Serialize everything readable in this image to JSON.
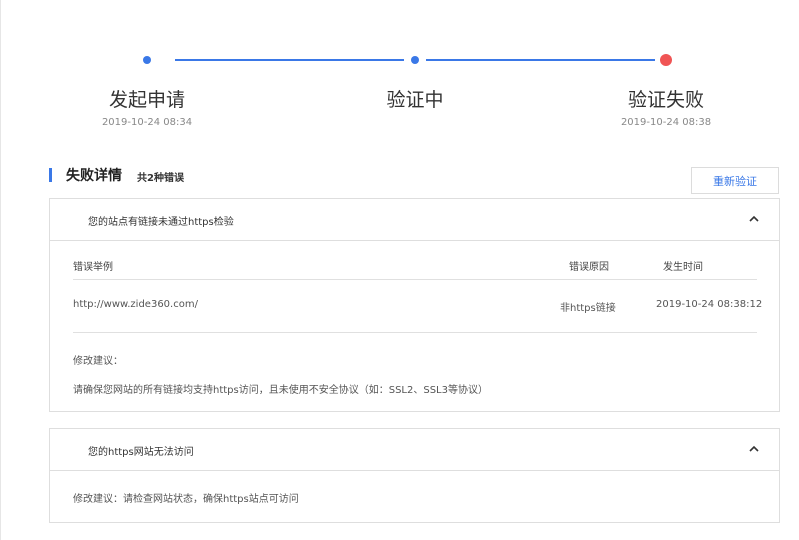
{
  "steps": [
    {
      "title": "发起申请",
      "time": "2019-10-24 08:34"
    },
    {
      "title": "验证中",
      "time": ""
    },
    {
      "title": "验证失败",
      "time": "2019-10-24 08:38"
    }
  ],
  "colors": {
    "accent": "#3a78e7",
    "fail": "#f05454"
  },
  "section": {
    "title": "失败详情",
    "count": "共2种错误",
    "reverify_label": "重新验证"
  },
  "panel1": {
    "title": "您的站点有链接未通过https检验",
    "columns": [
      "错误举例",
      "错误原因",
      "发生时间"
    ],
    "rows": [
      {
        "example": "http://www.zide360.com/",
        "reason": "非https链接",
        "time": "2019-10-24 08:38:12"
      }
    ],
    "suggestion_label": "修改建议：",
    "suggestion": "请确保您网站的所有链接均支持https访问，且未使用不安全协议（如：SSL2、SSL3等协议）"
  },
  "panel2": {
    "title": "您的https网站无法访问",
    "suggestion": "修改建议：请检查网站状态，确保https站点可访问"
  },
  "icons": {
    "collapse": "chevron-up-icon"
  }
}
